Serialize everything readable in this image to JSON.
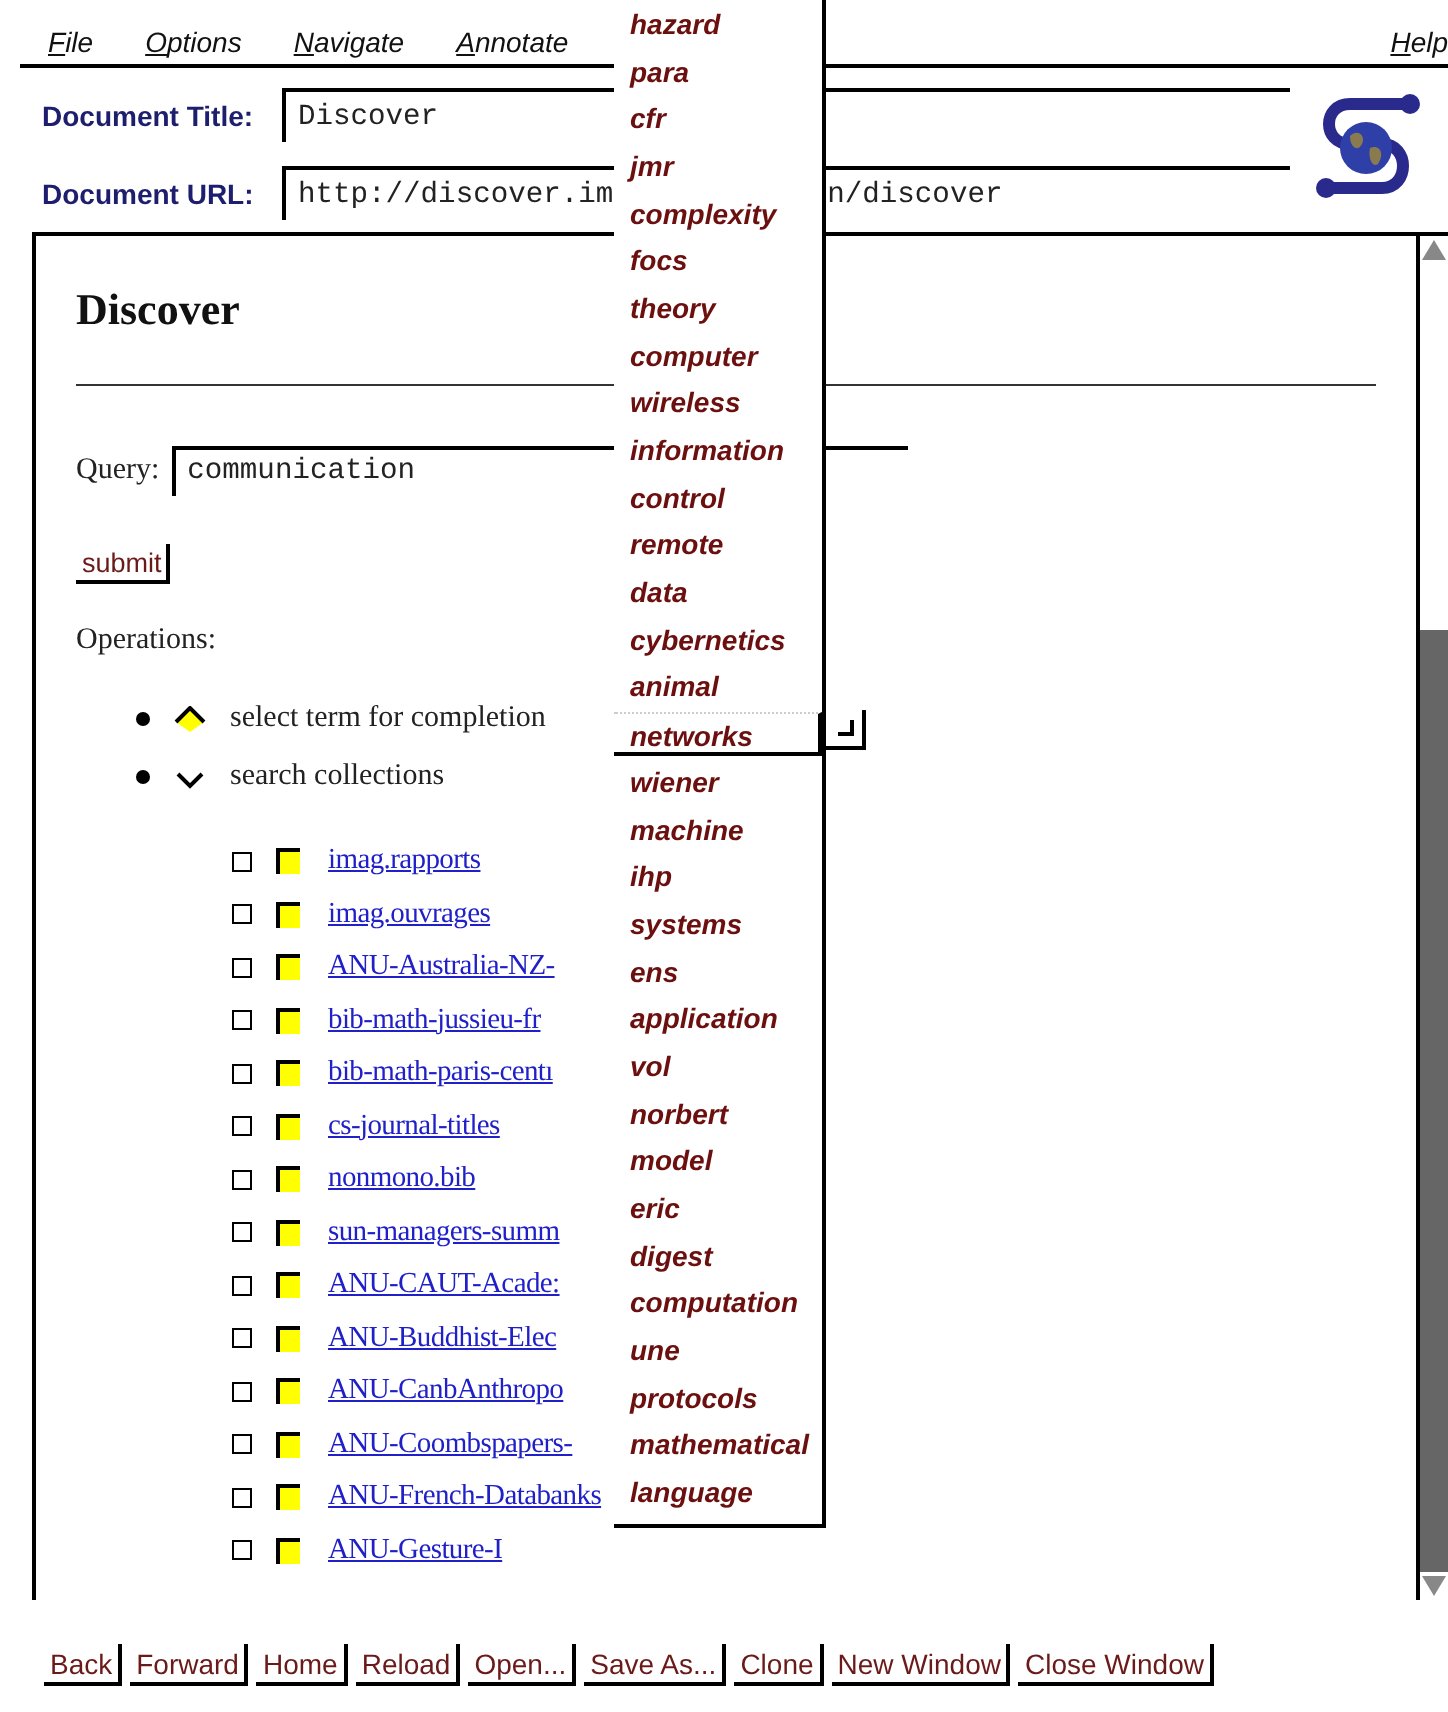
{
  "menu": [
    {
      "label": "File"
    },
    {
      "label": "Options"
    },
    {
      "label": "Navigate"
    },
    {
      "label": "Annotate"
    },
    {
      "label": "Help"
    }
  ],
  "document_title": {
    "label": "Document Title:",
    "value": "Discover"
  },
  "document_url": {
    "label": "Document URL:",
    "value_left": "http://discover.im",
    "value_right": "n/discover"
  },
  "page": {
    "heading": "Discover",
    "query_label": "Query:",
    "query_value": "communication",
    "submit": "submit",
    "operations_label": "Operations:",
    "operations": [
      {
        "label": "select term for completion",
        "selected": true
      },
      {
        "label": "search collections",
        "selected": false
      }
    ],
    "collections": [
      {
        "name": "imag.rapports",
        "checked": false
      },
      {
        "name": "imag.ouvrages",
        "checked": false
      },
      {
        "name": "ANU-Australia-NZ-",
        "checked": false
      },
      {
        "name": "bib-math-jussieu-fr",
        "checked": false
      },
      {
        "name": "bib-math-paris-centı",
        "checked": false
      },
      {
        "name": "cs-journal-titles",
        "checked": false
      },
      {
        "name": "nonmono.bib",
        "checked": false
      },
      {
        "name": "sun-managers-summ",
        "checked": false
      },
      {
        "name": "ANU-CAUT-Acade:",
        "checked": false
      },
      {
        "name": "ANU-Buddhist-Elec",
        "checked": false
      },
      {
        "name": "ANU-CanbAnthropo",
        "checked": false
      },
      {
        "name": "ANU-Coombspapers-",
        "checked": false
      },
      {
        "name": "ANU-French-Databanks",
        "checked": false
      },
      {
        "name": "ANU-Gesture-I",
        "checked": false
      }
    ]
  },
  "term_menu": {
    "items": [
      {
        "label": "hazard",
        "selected": false
      },
      {
        "label": "para",
        "selected": false
      },
      {
        "label": "cfr",
        "selected": false
      },
      {
        "label": "jmr",
        "selected": false
      },
      {
        "label": "complexity",
        "selected": false
      },
      {
        "label": "focs",
        "selected": false
      },
      {
        "label": "theory",
        "selected": false
      },
      {
        "label": "computer",
        "selected": false
      },
      {
        "label": "wireless",
        "selected": false
      },
      {
        "label": "information",
        "selected": false
      },
      {
        "label": "control",
        "selected": false
      },
      {
        "label": "remote",
        "selected": false
      },
      {
        "label": "data",
        "selected": false
      },
      {
        "label": "cybernetics",
        "selected": false
      },
      {
        "label": "animal",
        "selected": false
      },
      {
        "label": "networks",
        "selected": true
      },
      {
        "label": "wiener",
        "selected": false
      },
      {
        "label": "machine",
        "selected": false
      },
      {
        "label": "ihp",
        "selected": false
      },
      {
        "label": "systems",
        "selected": false
      },
      {
        "label": "ens",
        "selected": false
      },
      {
        "label": "application",
        "selected": false
      },
      {
        "label": "vol",
        "selected": false
      },
      {
        "label": "norbert",
        "selected": false
      },
      {
        "label": "model",
        "selected": false
      },
      {
        "label": "eric",
        "selected": false
      },
      {
        "label": "digest",
        "selected": false
      },
      {
        "label": "computation",
        "selected": false
      },
      {
        "label": "une",
        "selected": false
      },
      {
        "label": "protocols",
        "selected": false
      },
      {
        "label": "mathematical",
        "selected": false
      },
      {
        "label": "language",
        "selected": false
      }
    ]
  },
  "buttons": [
    {
      "label": "Back"
    },
    {
      "label": "Forward"
    },
    {
      "label": "Home"
    },
    {
      "label": "Reload"
    },
    {
      "label": "Open..."
    },
    {
      "label": "Save As..."
    },
    {
      "label": "Clone"
    },
    {
      "label": "New Window"
    },
    {
      "label": "Close Window"
    }
  ]
}
